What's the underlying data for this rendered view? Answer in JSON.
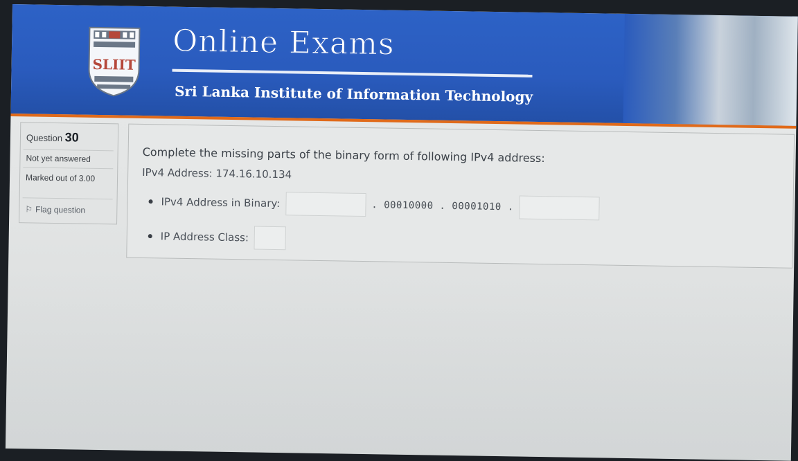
{
  "header": {
    "logo_text": "SLIIT",
    "title": "Online Exams",
    "subtitle": "Sri Lanka Institute of Information Technology"
  },
  "question_info": {
    "label": "Question",
    "number": "30",
    "status": "Not yet answered",
    "marked_out_of": "Marked out of 3.00",
    "flag_label": "Flag question",
    "flag_icon": "flag-icon"
  },
  "question": {
    "text": "Complete the missing parts of the binary form of following IPv4 address:",
    "ip_line": "IPv4 Address: 174.16.10.134",
    "binary_label": "IPv4 Address in Binary:",
    "binary_octet_2": ". 00010000 . 00001010 .",
    "binary_octet_1_value": "",
    "binary_octet_4_value": "",
    "class_label": "IP Address Class:",
    "class_value": ""
  },
  "colors": {
    "banner_blue": "#2a5bbd",
    "accent_orange": "#e06a1a"
  }
}
